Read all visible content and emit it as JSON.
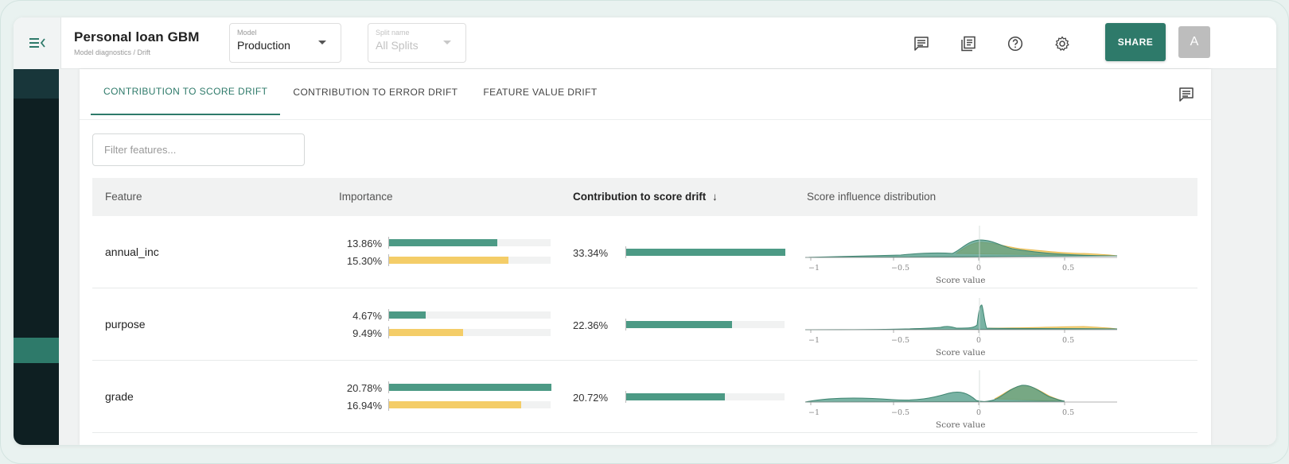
{
  "header": {
    "title": "Personal loan GBM",
    "breadcrumb": "Model diagnostics / Drift",
    "model_select": {
      "label": "Model",
      "value": "Production"
    },
    "split_select": {
      "label": "Split name",
      "value": "All Splits"
    },
    "share_label": "SHARE",
    "avatar_initial": "A",
    "icons": [
      "comment-icon",
      "notes-icon",
      "help-icon",
      "settings-icon"
    ]
  },
  "tabs": [
    {
      "label": "CONTRIBUTION TO SCORE DRIFT",
      "active": true
    },
    {
      "label": "CONTRIBUTION TO ERROR DRIFT",
      "active": false
    },
    {
      "label": "FEATURE VALUE DRIFT",
      "active": false
    }
  ],
  "filter": {
    "placeholder": "Filter features...",
    "value": ""
  },
  "table": {
    "columns": [
      "Feature",
      "Importance",
      "Contribution to score drift",
      "Score influence distribution"
    ],
    "sort_indicator": "↓",
    "dist_axis": {
      "ticks": [
        "−1",
        "−0.5",
        "0",
        "0.5"
      ],
      "title": "Score value"
    },
    "rows": [
      {
        "feature": "annual_inc",
        "importance_a": "13.86%",
        "importance_a_frac": 0.667,
        "importance_b": "15.30%",
        "importance_b_frac": 0.736,
        "contribution": "33.34%",
        "contribution_frac": 1.0
      },
      {
        "feature": "purpose",
        "importance_a": "4.67%",
        "importance_a_frac": 0.225,
        "importance_b": "9.49%",
        "importance_b_frac": 0.457,
        "contribution": "22.36%",
        "contribution_frac": 0.667
      },
      {
        "feature": "grade",
        "importance_a": "20.78%",
        "importance_a_frac": 1.0,
        "importance_b": "16.94%",
        "importance_b_frac": 0.815,
        "contribution": "20.72%",
        "contribution_frac": 0.62
      }
    ]
  },
  "colors": {
    "accent": "#2e7a6a",
    "series_a": "#4c9a85",
    "series_b": "#f4cd68",
    "sidebar": "#0e1f22"
  }
}
